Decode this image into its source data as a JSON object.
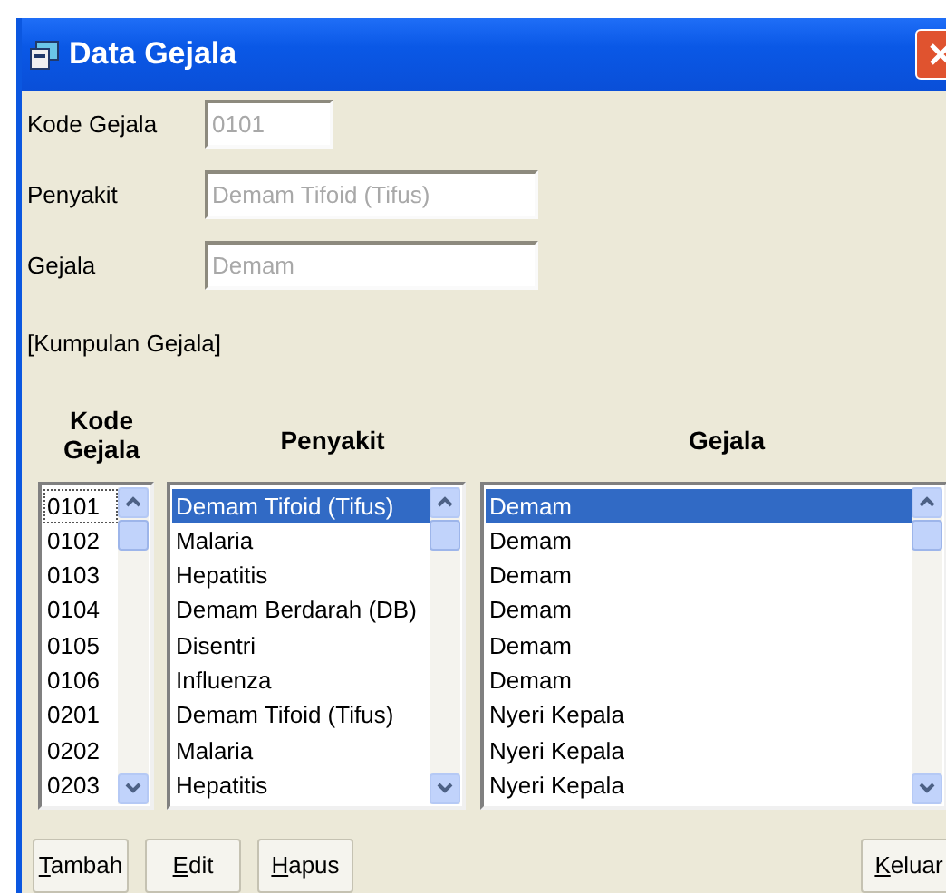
{
  "window": {
    "title": "Data Gejala"
  },
  "fields": [
    {
      "label": "Kode Gejala",
      "value": "0101",
      "disabled": true
    },
    {
      "label": "Penyakit",
      "value": "Demam Tifoid (Tifus)",
      "disabled": true
    },
    {
      "label": "Gejala",
      "value": "Demam",
      "disabled": true
    }
  ],
  "group_label": "[Kumpulan Gejala]",
  "lists": [
    {
      "heading": "Kode Gejala",
      "items": [
        {
          "text": "0101",
          "selected": false,
          "focused": true
        },
        {
          "text": "0102",
          "selected": false,
          "focused": false
        },
        {
          "text": "0103",
          "selected": false,
          "focused": false
        },
        {
          "text": "0104",
          "selected": false,
          "focused": false
        },
        {
          "text": "0105",
          "selected": false,
          "focused": false
        },
        {
          "text": "0106",
          "selected": false,
          "focused": false
        },
        {
          "text": "0201",
          "selected": false,
          "focused": false
        },
        {
          "text": "0202",
          "selected": false,
          "focused": false
        },
        {
          "text": "0203",
          "selected": false,
          "focused": false
        }
      ]
    },
    {
      "heading": "Penyakit",
      "items": [
        {
          "text": "Demam Tifoid (Tifus)",
          "selected": true,
          "focused": false
        },
        {
          "text": "Malaria",
          "selected": false,
          "focused": false
        },
        {
          "text": "Hepatitis",
          "selected": false,
          "focused": false
        },
        {
          "text": "Demam Berdarah (DB)",
          "selected": false,
          "focused": false
        },
        {
          "text": "Disentri",
          "selected": false,
          "focused": false
        },
        {
          "text": "Influenza",
          "selected": false,
          "focused": false
        },
        {
          "text": "Demam Tifoid (Tifus)",
          "selected": false,
          "focused": false
        },
        {
          "text": "Malaria",
          "selected": false,
          "focused": false
        },
        {
          "text": "Hepatitis",
          "selected": false,
          "focused": false
        }
      ]
    },
    {
      "heading": "Gejala",
      "items": [
        {
          "text": "Demam",
          "selected": true,
          "focused": false
        },
        {
          "text": "Demam",
          "selected": false,
          "focused": false
        },
        {
          "text": "Demam",
          "selected": false,
          "focused": false
        },
        {
          "text": "Demam",
          "selected": false,
          "focused": false
        },
        {
          "text": "Demam",
          "selected": false,
          "focused": false
        },
        {
          "text": "Demam",
          "selected": false,
          "focused": false
        },
        {
          "text": "Nyeri Kepala",
          "selected": false,
          "focused": false
        },
        {
          "text": "Nyeri Kepala",
          "selected": false,
          "focused": false
        },
        {
          "text": "Nyeri Kepala",
          "selected": false,
          "focused": false
        }
      ]
    }
  ],
  "buttons": [
    "Tambah",
    "Edit",
    "Hapus"
  ],
  "exit_button": "Keluar"
}
